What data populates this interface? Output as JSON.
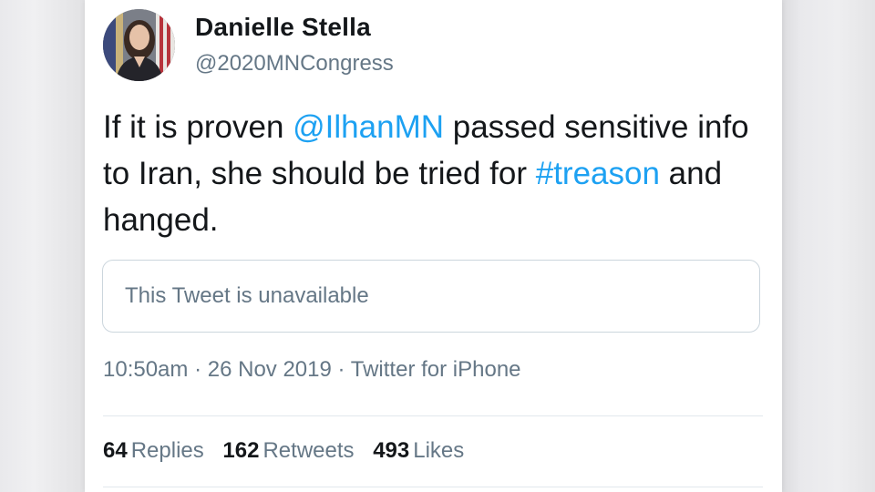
{
  "tweet": {
    "author": {
      "display_name": "Danielle Stella",
      "handle": "@2020MNCongress"
    },
    "text": {
      "part1": "If it is proven ",
      "mention": "@IlhanMN",
      "part2": " passed sensitive info to Iran, she should be tried for ",
      "hashtag": "#treason",
      "part3": " and hanged."
    },
    "quoted": {
      "message": "This Tweet is unavailable"
    },
    "meta": {
      "time": "10:50am",
      "separator": "·",
      "date": "26 Nov 2019",
      "source": "Twitter for iPhone"
    },
    "stats": {
      "replies_count": "64",
      "replies_label": "Replies",
      "retweets_count": "162",
      "retweets_label": "Retweets",
      "likes_count": "493",
      "likes_label": "Likes"
    }
  },
  "colors": {
    "link": "#1da1f2",
    "text": "#14171a",
    "secondary": "#657786",
    "border": "#ccd6dd"
  }
}
